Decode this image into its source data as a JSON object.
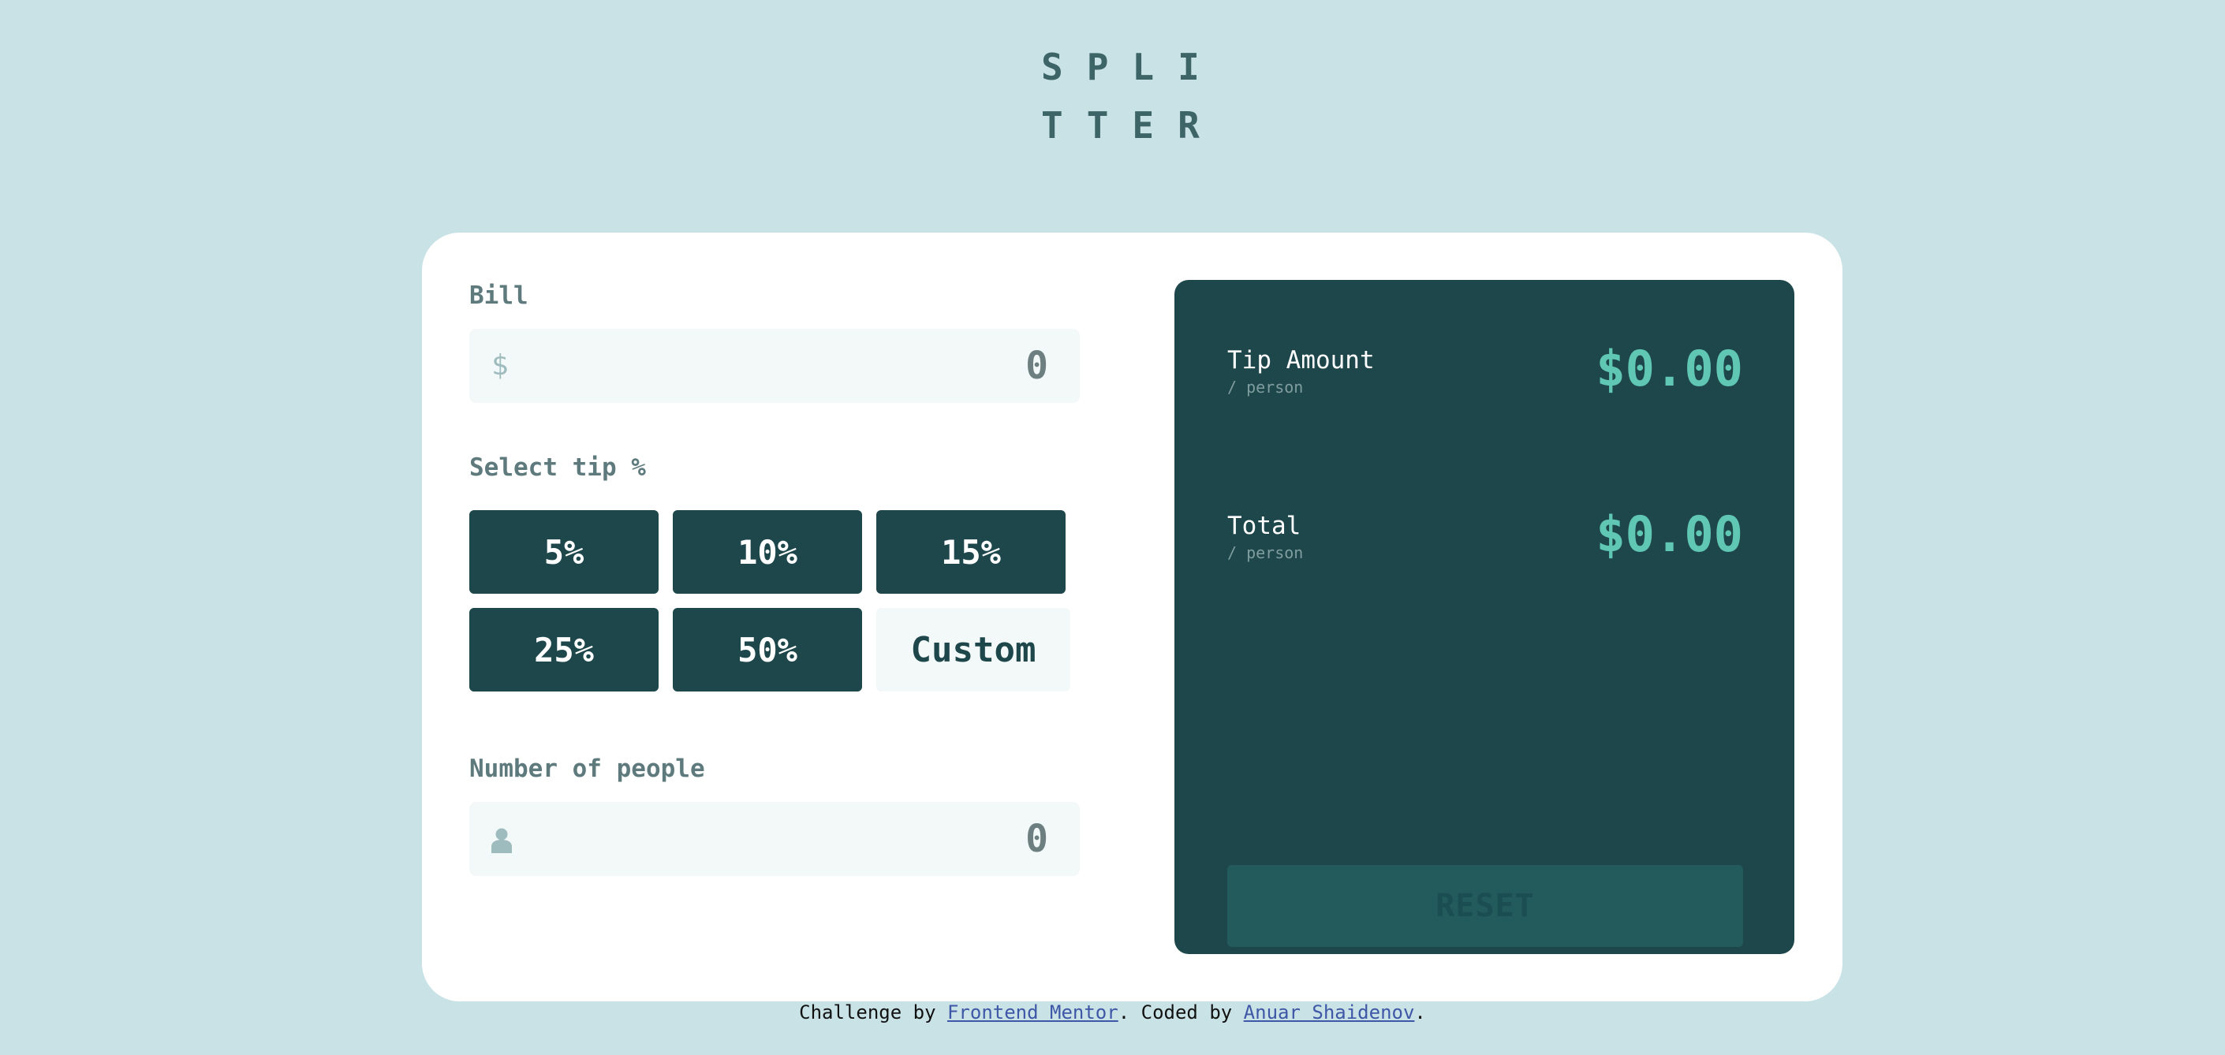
{
  "app": {
    "logo_line1": "SPLI",
    "logo_line2": "TTER"
  },
  "form": {
    "bill_label": "Bill",
    "bill_currency_icon": "$",
    "bill_value": "0",
    "tip_label": "Select tip %",
    "tip_options": [
      "5%",
      "10%",
      "15%",
      "25%",
      "50%"
    ],
    "custom_tip_label": "Custom",
    "people_label": "Number of people",
    "people_value": "0"
  },
  "results": {
    "tip_amount_label": "Tip Amount",
    "tip_amount_sub": "/ person",
    "tip_amount_value": "$0.00",
    "total_label": "Total",
    "total_sub": "/ person",
    "total_value": "$0.00",
    "reset_label": "RESET"
  },
  "footer": {
    "prefix": "Challenge by ",
    "link1": "Frontend Mentor",
    "middle": ". Coded by ",
    "link2": "Anuar Shaidenov",
    "suffix": "."
  },
  "colors": {
    "background": "#c9e2e6",
    "primary": "#1e474c",
    "accent": "#5fc7b4",
    "input_bg": "#f3f9f9"
  },
  "icons": {
    "bill": "dollar-icon",
    "people": "person-icon"
  }
}
